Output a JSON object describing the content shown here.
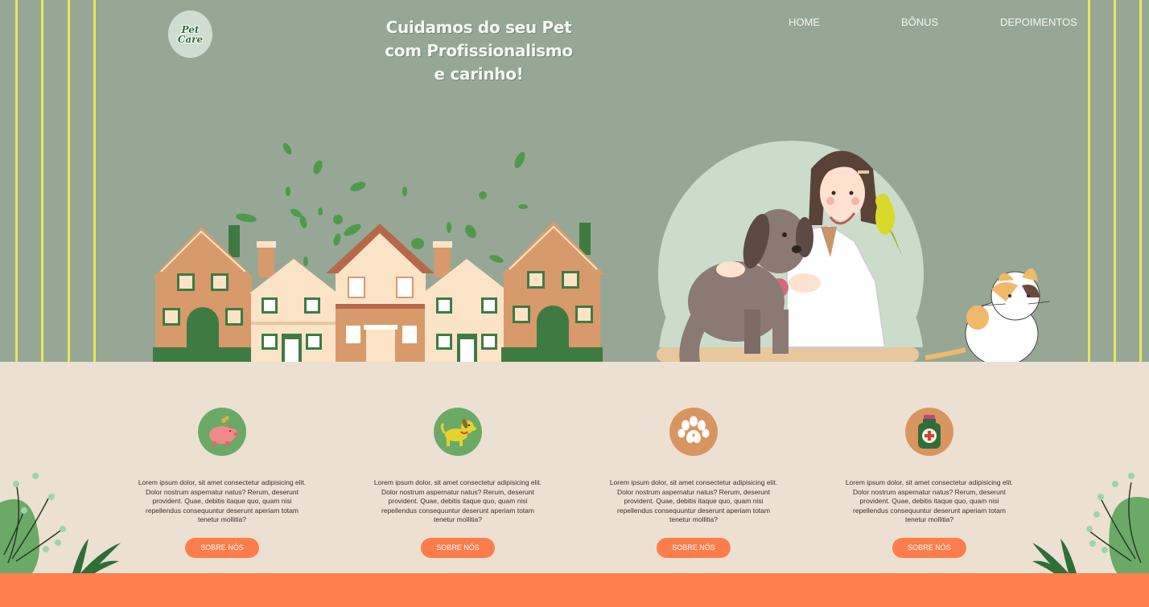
{
  "header": {
    "logo_text": "Pet Care",
    "tagline": "Cuidamos do seu Pet com Profissionalismo e carinho!",
    "nav": [
      {
        "label": "HOME"
      },
      {
        "label": "BÔNUS"
      },
      {
        "label": "DEPOIMENTOS"
      }
    ]
  },
  "features": [
    {
      "icon": "piggy-bank-icon",
      "text": "Lorem ipsum dolor, sit amet consectetur adipisicing elit. Dolor nostrum aspernatur natus? Rerum, deserunt provident. Quae, debitis itaque quo, quam nisi repellendus consequuntur deserunt aperiam totam tenetur mollitia?",
      "button": "SOBRE NÓS"
    },
    {
      "icon": "dog-icon",
      "text": "Lorem ipsum dolor, sit amet consectetur adipisicing elit. Dolor nostrum aspernatur natus? Rerum, deserunt provident. Quae, debitis itaque quo, quam nisi repellendus consequuntur deserunt aperiam totam tenetur mollitia?",
      "button": "SOBRE NÓS"
    },
    {
      "icon": "paw-print-icon",
      "text": "Lorem ipsum dolor, sit amet consectetur adipisicing elit. Dolor nostrum aspernatur natus? Rerum, deserunt provident. Quae, debitis itaque quo, quam nisi repellendus consequuntur deserunt aperiam totam tenetur mollitia?",
      "button": "SOBRE NÓS"
    },
    {
      "icon": "medicine-bottle-icon",
      "text": "Lorem ipsum dolor, sit amet consectetur adipisicing elit. Dolor nostrum aspernatur natus? Rerum, deserunt provident. Quae, debitis itaque quo, quam nisi repellendus consequuntur deserunt aperiam totam tenetur mollitia?",
      "button": "SOBRE NÓS"
    }
  ],
  "colors": {
    "hero_bg": "#97a795",
    "section_bg": "#ece0d2",
    "accent": "#ff7d4b",
    "stripe": "#e9e55a"
  }
}
